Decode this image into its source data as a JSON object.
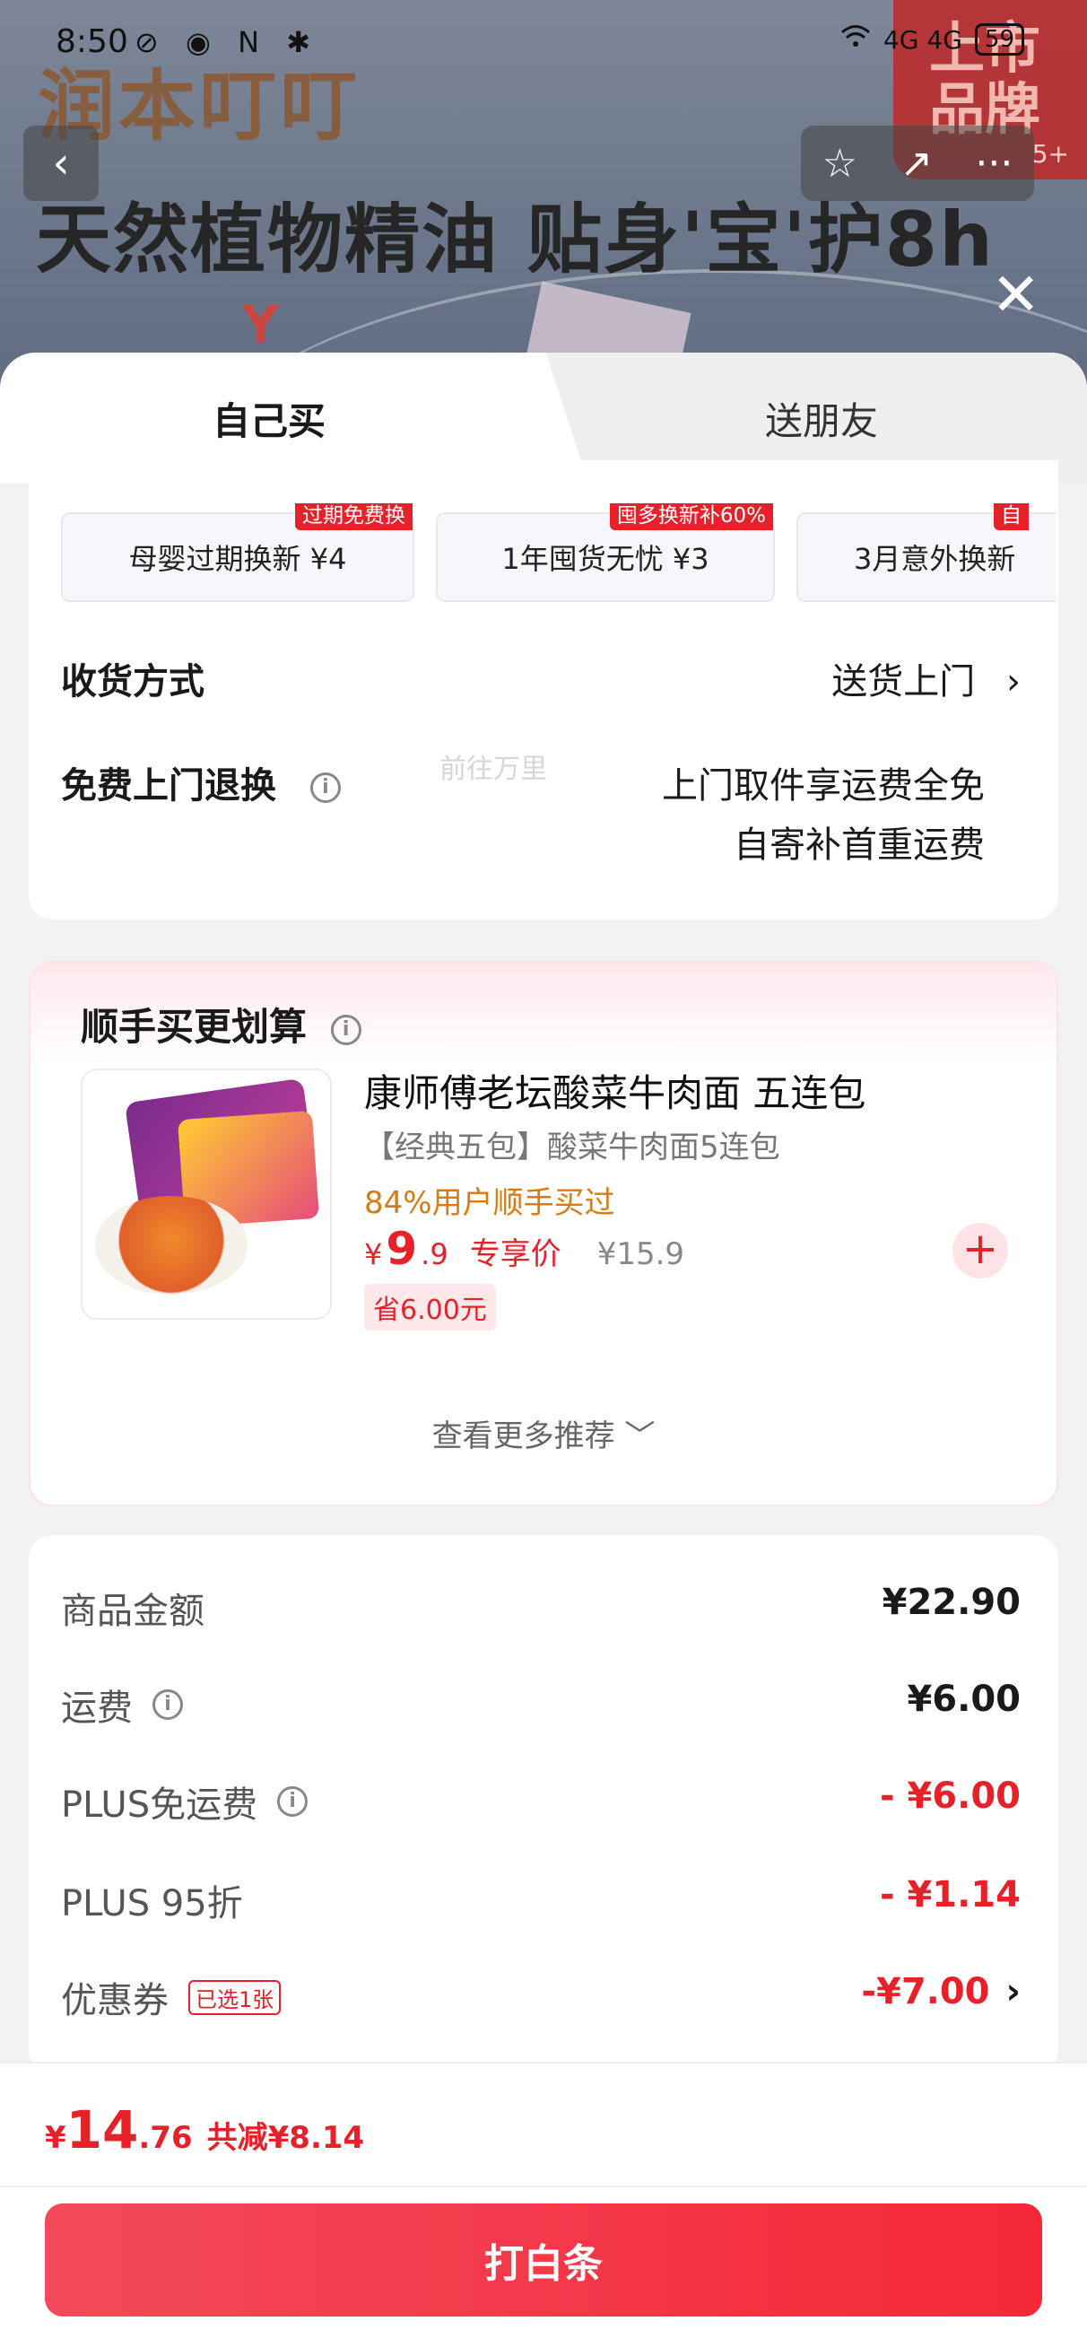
{
  "status_bar": {
    "time": "8:50",
    "left_icons": "⊘ ◉ N ✱",
    "network": "4G 4G",
    "battery": "59"
  },
  "banner": {
    "brand_text": "润本叮叮",
    "ad_text": "天然植物精油 贴身'宝'护8h",
    "badge_text": "上市品牌",
    "badge_count": "5+"
  },
  "nav": {
    "back": "‹",
    "star": "☆",
    "share": "↗",
    "more": "···",
    "close": "✕"
  },
  "tabs": {
    "self": "自己买",
    "gift": "送朋友"
  },
  "services": [
    {
      "label": "母婴过期换新 ¥4",
      "tag": "过期免费换"
    },
    {
      "label": "1年囤货无忧 ¥3",
      "tag": "囤多换新补60%"
    },
    {
      "label": "3月意外换新",
      "tag": "自"
    }
  ],
  "delivery": {
    "label": "收货方式",
    "value": "送货上门",
    "chevron": "›"
  },
  "returns": {
    "label": "免费上门退换",
    "info": "i",
    "line1": "上门取件享运费全免",
    "line2": "自寄补首重运费"
  },
  "addon": {
    "heading": "顺手买更划算",
    "info": "i",
    "product": {
      "title": "康师傅老坛酸菜牛肉面 五连包",
      "spec": "【经典五包】酸菜牛肉面5连包",
      "bought": "84%用户顺手买过",
      "currency": "¥",
      "price_int": "9",
      "price_dec": ".9",
      "exclusive": "专享价",
      "orig_price": "¥15.9",
      "save": "省6.00元",
      "add": "+"
    },
    "more": "查看更多推荐 ﹀",
    "watermark": "前往万里"
  },
  "price_details": {
    "goods_label": "商品金额",
    "goods_value": "¥22.90",
    "shipping_label": "运费",
    "shipping_value": "¥6.00",
    "plus_ship_label": "PLUS免运费",
    "plus_ship_value": "- ¥6.00",
    "plus_disc_label": "PLUS 95折",
    "plus_disc_value": "- ¥1.14",
    "coupon_label": "优惠券",
    "coupon_tag": "已选1张",
    "coupon_value": "-¥7.00",
    "coupon_chevron": "›",
    "info": "i"
  },
  "footer": {
    "currency": "¥",
    "total_int": "14",
    "total_dec": ".76",
    "reduced": "共减¥8.14",
    "pay_button": "打白条"
  },
  "colors": {
    "accent": "#e6212a",
    "button": "#f52839",
    "orange": "#d97a12"
  }
}
